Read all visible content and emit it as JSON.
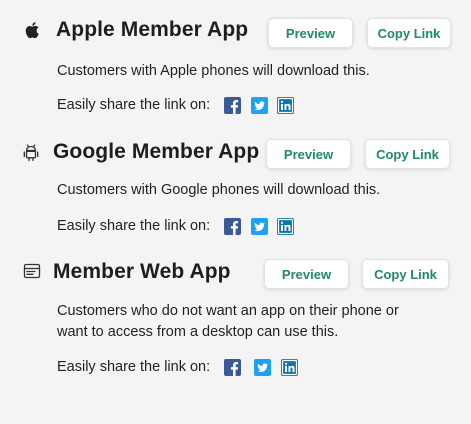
{
  "apps": [
    {
      "icon": "apple-icon",
      "title": "Apple Member App",
      "preview_label": "Preview",
      "copy_label": "Copy Link",
      "description": "Customers with Apple phones will download this.",
      "share_label": "Easily share the link on:"
    },
    {
      "icon": "android-icon",
      "title": "Google Member App",
      "preview_label": "Preview",
      "copy_label": "Copy Link",
      "description": "Customers with Google phones will download this.",
      "share_label": "Easily share the link on:"
    },
    {
      "icon": "browser-window-icon",
      "title": "Member Web App",
      "preview_label": "Preview",
      "copy_label": "Copy Link",
      "description": "Customers who do not want an app on their phone or want to access from a desktop can use this.",
      "share_label": "Easily share the link on:"
    }
  ],
  "social": [
    {
      "icon": "facebook-icon",
      "color": "#3b5998"
    },
    {
      "icon": "twitter-icon",
      "color": "#1da1f2"
    },
    {
      "icon": "linkedin-icon",
      "color": "#0e76a8"
    }
  ],
  "colors": {
    "accent": "#1f8a63",
    "background": "#f4f4f4"
  }
}
